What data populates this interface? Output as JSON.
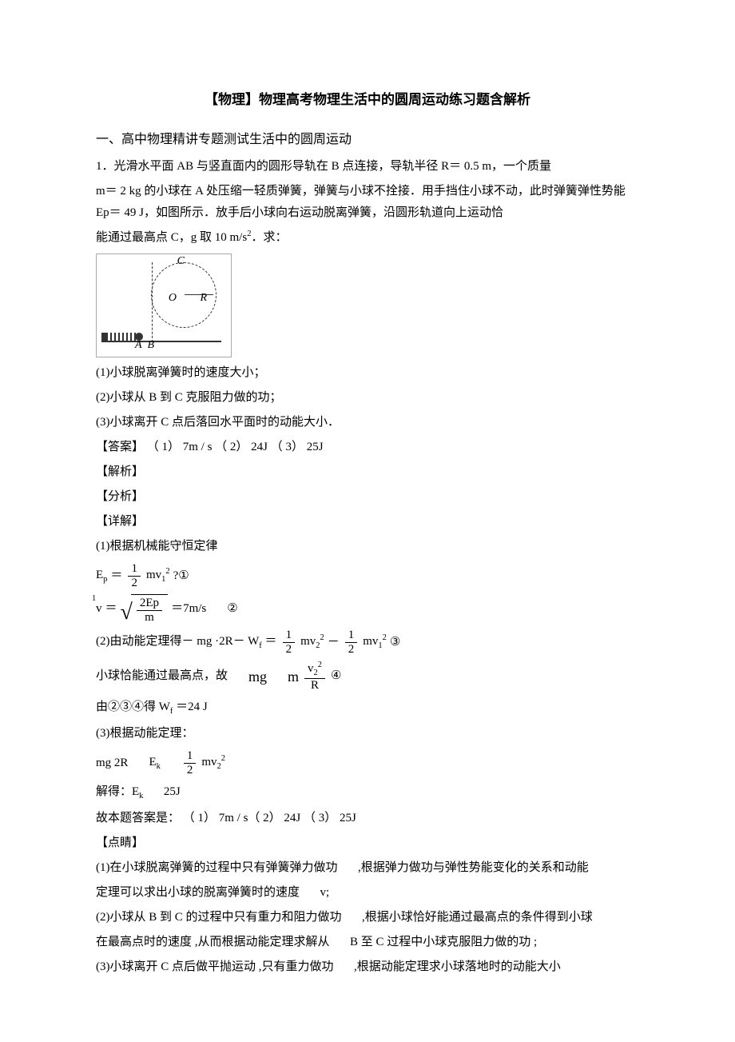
{
  "title": "【物理】物理高考物理生活中的圆周运动练习题含解析",
  "section": "一、高中物理精讲专题测试生活中的圆周运动",
  "q1_p1": "1．光滑水平面   AB 与竖直面内的圆形导轨在    B 点连接，导轨半径    R＝ 0.5 m，一个质量",
  "q1_p2": "m＝ 2 kg 的小球在 A 处压缩一轻质弹簧，弹簧与小球不拴接．用手挡住小球不动，此时弹簧弹性势能 Ep＝ 49 J，如图所示．放手后小球向右运动脱离弹簧，沿圆形轨道向上运动恰",
  "q1_p3_a": "能通过最高点   C，g 取 10 m/s",
  "q1_p3_b": "．求：",
  "sub_q1": "(1)小球脱离弹簧时的速度大小；",
  "sub_q2": "(2)小球从 B 到 C 克服阻力做的功；",
  "sub_q3": "(3)小球离开  C 点后落回水平面时的动能大小．",
  "ans_line": "【答案】 （ 1） 7m / s （ 2） 24J （ 3） 25J",
  "h_jiexi": "【解析】",
  "h_fenxi": "【分析】",
  "h_xiangjie": "【详解】",
  "step1_intro": "(1)根据机械能守恒定律",
  "eq1_left": "E",
  "eq1_sub": "p",
  "eq1_eq": "＝",
  "eq1_rhs": "mv",
  "eq1_tail": "?①",
  "eq2_lhs_sub": "1",
  "eq2_lhs": "v",
  "eq2_eq": "＝",
  "eq2_num": "2Ep",
  "eq2_den": "m",
  "eq2_val": "＝7m/s",
  "eq2_tag": "②",
  "step2_intro_a": "(2)由动能定理得－  mg ·2R－ W",
  "step2_intro_sub": "f",
  "step2_intro_b": " ＝",
  "eq3_num1": "1",
  "eq3_den1": "2",
  "eq3_mid1": "mv",
  "eq3_sub1": "2",
  "eq3_sup1": "2",
  "eq3_minus": "－",
  "eq3_num2": "1",
  "eq3_den2": "2",
  "eq3_mid2": "mv",
  "eq3_sub2": "1",
  "eq3_sup2": "2",
  "eq3_tag": "③",
  "step2_line2_a": "小球恰能通过最高点，故",
  "eq4_lhs": "mg",
  "eq4_rhs_m": "m",
  "eq4_num": "v",
  "eq4_numsub": "2",
  "eq4_numsup": "2",
  "eq4_den": "R",
  "eq4_tag": "④",
  "step2_result": "由②③④得   W",
  "step2_result_sub": "f",
  "step2_result_val": " ＝24 J",
  "step3_intro": "(3)根据动能定理：",
  "eq5_a": "mg 2R",
  "eq5_b": "E",
  "eq5_b_sub": "k",
  "eq5_num": "1",
  "eq5_den": "2",
  "eq5_rhs": "mv",
  "eq5_rhs_sub": "2",
  "eq5_rhs_sup": "2",
  "step3_result_a": "解得：E",
  "step3_result_sub": "k",
  "step3_result_b": "25J",
  "final_ans": "故本题答案是：   （ 1） 7m / s（ 2） 24J  （ 3） 25J",
  "h_dianjing": "【点睛】",
  "dj_1a": "(1)在小球脱离弹簧的过程中只有弹簧弹力做功",
  "dj_1b": ",根据弹力做功与弹性势能变化的关系和动能",
  "dj_1c": "定理可以求出小球的脱离弹簧时的速度",
  "dj_1d": "v;",
  "dj_2a": "(2)小球从 B 到 C 的过程中只有重力和阻力做功",
  "dj_2b": ",根据小球恰好能通过最高点的条件得到小球",
  "dj_2c": "在最高点时的速度  ,从而根据动能定理求解从",
  "dj_2d": "B 至 C 过程中小球克服阻力做的功   ;",
  "dj_3a": "(3)小球离开  C 点后做平抛运动  ,只有重力做功",
  "dj_3b": ",根据动能定理求小球落地时的动能大小",
  "diagram_labels": {
    "A": "A",
    "B": "B",
    "C": "C",
    "O": "O",
    "R": "R"
  },
  "frac_one": "1",
  "frac_two": "2"
}
